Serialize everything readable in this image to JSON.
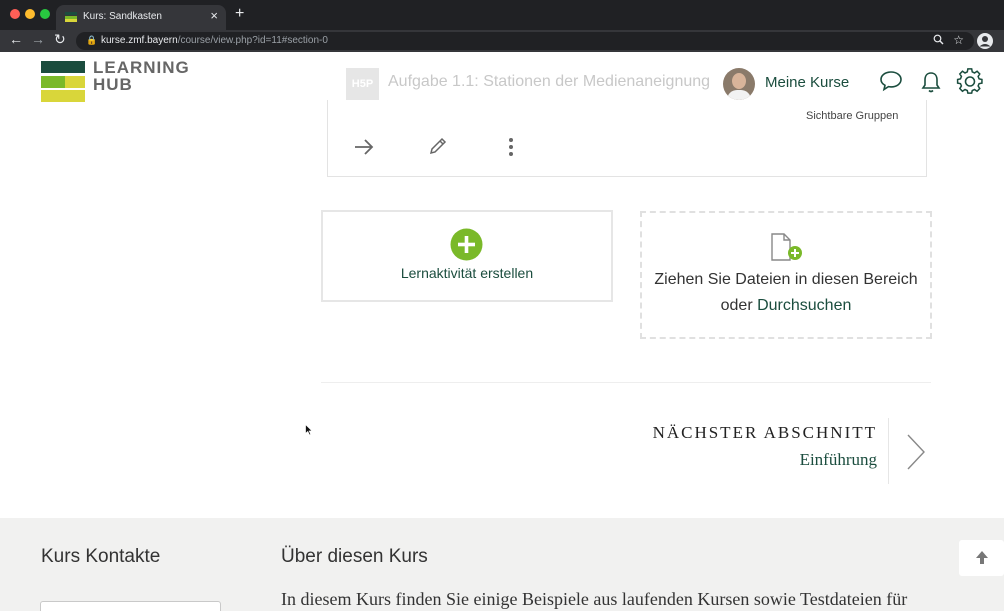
{
  "browser": {
    "tab_title": "Kurs: Sandkasten",
    "tab_close": "×",
    "new_tab": "+",
    "back": "←",
    "forward": "→",
    "reload": "↻",
    "lock": "🔒",
    "url_host": "kurse.zmf.bayern",
    "url_path": "/course/view.php?id=11#section-0"
  },
  "header": {
    "logo_line1": "LEARNING",
    "logo_line2": "HUB",
    "h5p_badge": "H5P",
    "activity_title": "Aufgabe 1.1: Stationen der Medienaneignung",
    "user_menu_label": "Meine Kurse"
  },
  "activity": {
    "visibility": "Sichtbare Gruppen"
  },
  "create_activity": {
    "label": "Lernaktivität erstellen"
  },
  "dropzone": {
    "line1": "Ziehen Sie Dateien in diesen Bereich",
    "line2_prefix": "oder ",
    "browse_link": "Durchsuchen"
  },
  "next_section": {
    "label": "NÄCHSTER ABSCHNITT",
    "name": "Einführung"
  },
  "footer": {
    "contacts_heading": "Kurs Kontakte",
    "about_heading": "Über diesen Kurs",
    "about_text": "In diesem Kurs finden Sie einige Beispiele aus laufenden Kursen sowie Testdateien für"
  },
  "colors": {
    "brand_green": "#1b4d3e",
    "accent_green": "#7ab929",
    "logo_yellow": "#d9d63a",
    "footer_bg": "#f1f1f0"
  }
}
